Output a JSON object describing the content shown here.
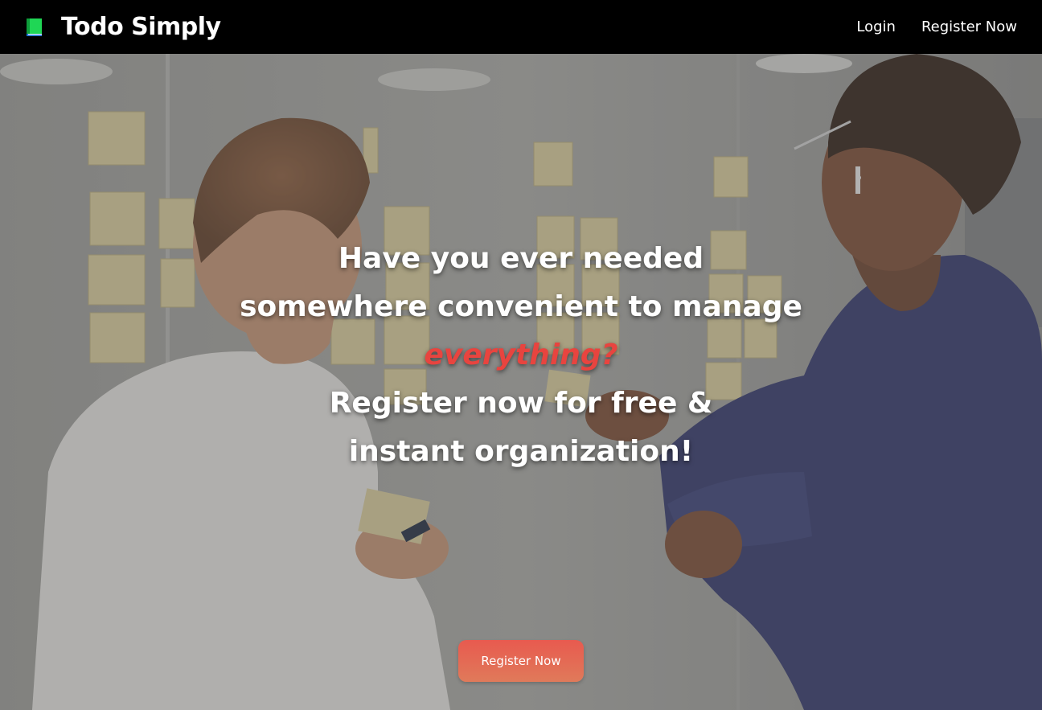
{
  "navbar": {
    "brand_name": "Todo Simply",
    "brand_icon": "book-icon",
    "links": [
      {
        "label": "Login"
      },
      {
        "label": "Register Now"
      }
    ]
  },
  "hero": {
    "line1": "Have you ever needed",
    "line2": "somewhere convenient to manage",
    "accent_word": "everything?",
    "line4": "Register now for free &",
    "line5": "instant organization!",
    "cta_label": "Register Now"
  },
  "colors": {
    "navbar_bg": "#000000",
    "accent": "#e8443f",
    "cta_gradient_top": "#e85a4f",
    "cta_gradient_bottom": "#e07a5a",
    "brand_icon": "#22c55e"
  }
}
